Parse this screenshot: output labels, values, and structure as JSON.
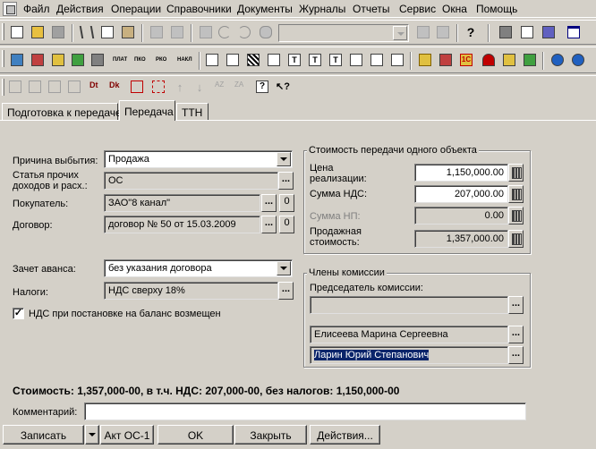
{
  "menu": [
    "Файл",
    "Действия",
    "Операции",
    "Справочники",
    "Документы",
    "Журналы",
    "Отчеты",
    "Сервис",
    "Окна",
    "Помощь"
  ],
  "toolbar2_labels": [
    "ПЛАТ",
    "ПКО",
    "РКО",
    "НАКЛ"
  ],
  "toolbar2_badge": "1С",
  "tabs": [
    "Подготовка к передаче",
    "Передача",
    "ТТН"
  ],
  "form": {
    "reason_label": "Причина выбытия:",
    "reason_value": "Продажа",
    "article_label": "Статья прочих доходов и расх.:",
    "article_value": "ОС",
    "buyer_label": "Покупатель:",
    "buyer_value": "ЗАО\"8 канал\"",
    "contract_label": "Договор:",
    "contract_value": "договор № 50 от 15.03.2009",
    "zero_btn": "0",
    "advance_label": "Зачет аванса:",
    "advance_value": "без указания договора",
    "taxes_label": "Налоги:",
    "taxes_value": "НДС сверху 18%",
    "vat_check_label": "НДС при постановке на баланс возмещен",
    "vat_check_mark": "✓"
  },
  "cost": {
    "title": "Стоимость передачи одного объекта",
    "price_label": "Цена реализации:",
    "price_value": "1,150,000.00",
    "vat_label": "Сумма НДС:",
    "vat_value": "207,000.00",
    "np_label": "Сумма НП:",
    "np_value": "0.00",
    "sale_label": "Продажная стоимость:",
    "sale_value": "1,357,000.00"
  },
  "commission": {
    "title": "Члены комиссии",
    "chair_label": "Председатель комиссии:",
    "chair_value": "",
    "member1": "Елисеева Марина Сергеевна",
    "member2": "Ларин Юрий Степанович"
  },
  "summary": "Стоимость: 1,357,000-00, в т.ч. НДС: 207,000-00, без налогов: 1,150,000-00",
  "comment_label": "Комментарий:",
  "comment_value": "",
  "buttons": {
    "record": "Записать",
    "act": "Акт ОС-1",
    "ok": "OK",
    "close": "Закрыть",
    "actions": "Действия..."
  },
  "ellipsis": "..."
}
